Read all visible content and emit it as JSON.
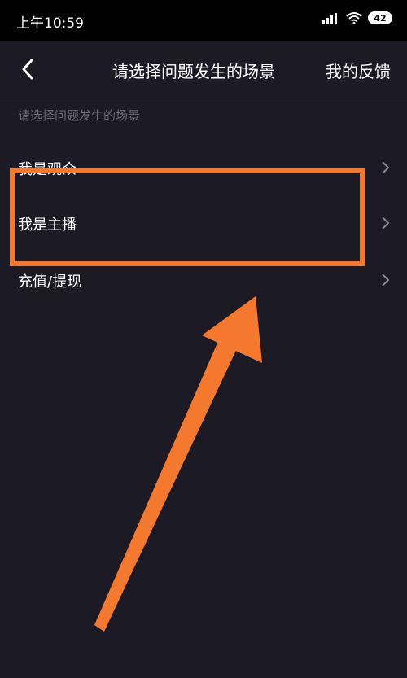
{
  "status_bar": {
    "time": "上午10:59",
    "battery": "42",
    "icons": [
      "signal-icon",
      "wifi-icon",
      "battery-icon"
    ]
  },
  "nav": {
    "back_icon": "chevron-left-icon",
    "title": "请选择问题发生的场景",
    "feedback_label": "我的反馈"
  },
  "section_label": "请选择问题发生的场景",
  "items": [
    {
      "label": "我是观众"
    },
    {
      "label": "我是主播"
    },
    {
      "label": "充值/提现"
    }
  ],
  "colors": {
    "background": "#1b1a25",
    "highlight": "#f5782f",
    "muted_text": "#6b6a75"
  }
}
